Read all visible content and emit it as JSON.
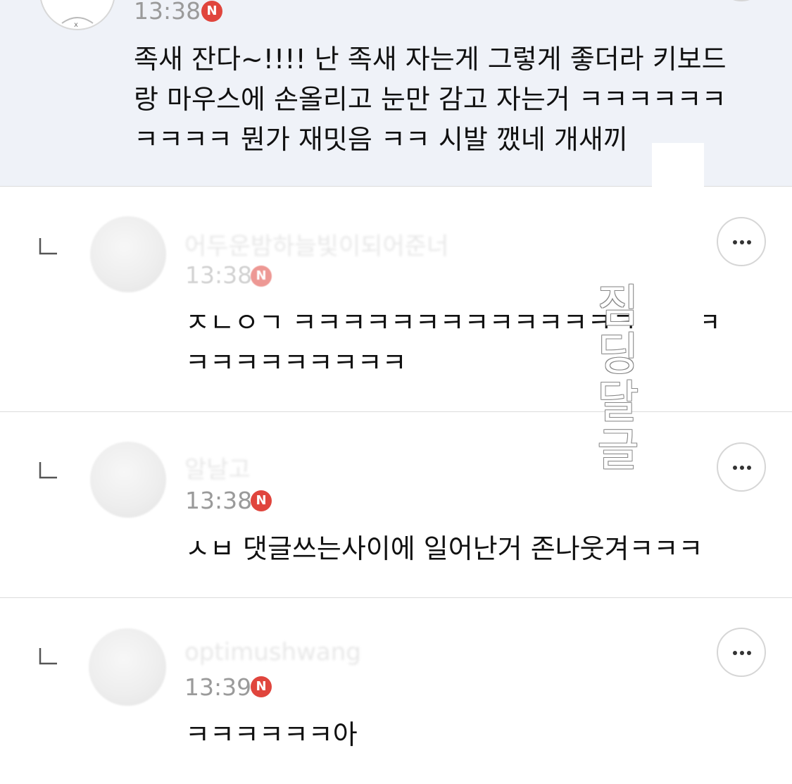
{
  "comments": [
    {
      "nickname": "",
      "time": "13:38",
      "new_badge": "N",
      "text": "족새 잔다~!!!! 난 족새 자는게 그렇게 좋더라 키보드\n랑 마우스에 손올리고 눈만 감고 자는거 ㅋㅋㅋㅋㅋㅋ\nㅋㅋㅋㅋ 뭔가 재밋음 ㅋㅋ 시발 깼네 개새끼"
    },
    {
      "nickname": "어두운밤하늘빛이되어준너",
      "time": "13:38",
      "new_badge": "N",
      "text": "ㅈㄴㅇㄱ ㅋㅋㅋㅋㅋㅋㅋㅋㅋㅋㅋㅋㅋㅋ       ㅋ\nㅋㅋㅋㅋㅋㅋㅋㅋㅋ"
    },
    {
      "nickname": "알날고",
      "time": "13:38",
      "new_badge": "N",
      "text": "ㅅㅂ 댓글쓰는사이에 일어난거 존나웃겨ㅋㅋㅋ"
    },
    {
      "nickname": "optimushwang",
      "time": "13:39",
      "new_badge": "N",
      "text": "ㅋㅋㅋㅋㅋㅋ아"
    }
  ],
  "watermark": "짐딩달글",
  "icons": {
    "reply": "reply-arrow-icon",
    "more": "more-dots-icon",
    "avatar": "user-avatar-icon"
  },
  "colors": {
    "highlight_bg": "#eff2f8",
    "badge": "#e0453d",
    "time": "#9a9a9a",
    "divider": "#dcdcdc"
  }
}
